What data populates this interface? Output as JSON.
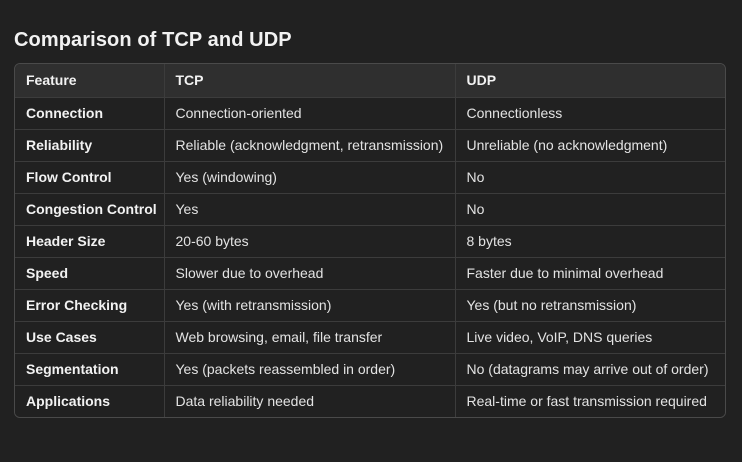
{
  "title": "Comparison of TCP and UDP",
  "table": {
    "headers": [
      "Feature",
      "TCP",
      "UDP"
    ],
    "rows": [
      [
        "Connection",
        "Connection-oriented",
        "Connectionless"
      ],
      [
        "Reliability",
        "Reliable (acknowledgment, retransmission)",
        "Unreliable (no acknowledgment)"
      ],
      [
        "Flow Control",
        "Yes (windowing)",
        "No"
      ],
      [
        "Congestion Control",
        "Yes",
        "No"
      ],
      [
        "Header Size",
        "20-60 bytes",
        "8 bytes"
      ],
      [
        "Speed",
        "Slower due to overhead",
        "Faster due to minimal overhead"
      ],
      [
        "Error Checking",
        "Yes (with retransmission)",
        "Yes (but no retransmission)"
      ],
      [
        "Use Cases",
        "Web browsing, email, file transfer",
        "Live video, VoIP, DNS queries"
      ],
      [
        "Segmentation",
        "Yes (packets reassembled in order)",
        "No (datagrams may arrive out of order)"
      ],
      [
        "Applications",
        "Data reliability needed",
        "Real-time or fast transmission required"
      ]
    ]
  }
}
